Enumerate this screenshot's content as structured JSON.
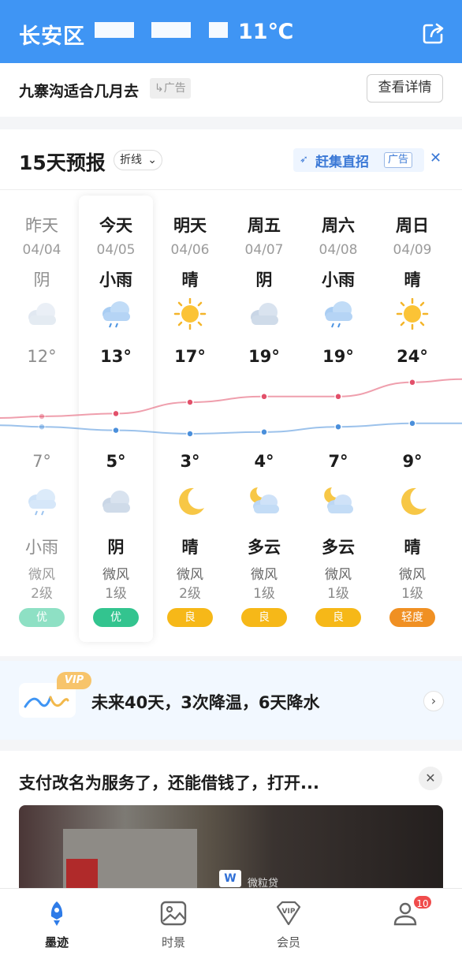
{
  "header": {
    "city": "长安区",
    "temperature": "11℃",
    "share_icon": "share-icon"
  },
  "ad_banner": {
    "title": "九寨沟适合几月去",
    "tag": "广告",
    "button": "查看详情"
  },
  "forecast": {
    "title": "15天预报",
    "mode": "折线",
    "ad": {
      "label": "赶集直招",
      "tag": "广告",
      "close": "✕"
    },
    "days": [
      {
        "day": "昨天",
        "date": "04/04",
        "weather_day": "阴",
        "icon_day": "cloud-icon",
        "high": "12°",
        "low": "7°",
        "icon_night": "cloud-rain-icon",
        "weather_night": "小雨",
        "wind": "微风",
        "level": "2级",
        "aqi": "优",
        "aqi_color": "#8ee0c4"
      },
      {
        "day": "今天",
        "date": "04/05",
        "weather_day": "小雨",
        "icon_day": "cloud-rain-icon",
        "high": "13°",
        "low": "5°",
        "icon_night": "cloud-icon",
        "weather_night": "阴",
        "wind": "微风",
        "level": "1级",
        "aqi": "优",
        "aqi_color": "#33c48f"
      },
      {
        "day": "明天",
        "date": "04/06",
        "weather_day": "晴",
        "icon_day": "sun-icon",
        "high": "17°",
        "low": "3°",
        "icon_night": "moon-icon",
        "weather_night": "晴",
        "wind": "微风",
        "level": "2级",
        "aqi": "良",
        "aqi_color": "#f6b818"
      },
      {
        "day": "周五",
        "date": "04/07",
        "weather_day": "阴",
        "icon_day": "cloud-icon",
        "high": "19°",
        "low": "4°",
        "icon_night": "moon-cloud-icon",
        "weather_night": "多云",
        "wind": "微风",
        "level": "1级",
        "aqi": "良",
        "aqi_color": "#f6b818"
      },
      {
        "day": "周六",
        "date": "04/08",
        "weather_day": "小雨",
        "icon_day": "cloud-rain-icon",
        "high": "19°",
        "low": "7°",
        "icon_night": "moon-cloud-icon",
        "weather_night": "多云",
        "wind": "微风",
        "level": "1级",
        "aqi": "良",
        "aqi_color": "#f6b818"
      },
      {
        "day": "周日",
        "date": "04/09",
        "weather_day": "晴",
        "icon_day": "sun-icon",
        "high": "24°",
        "low": "9°",
        "icon_night": "moon-icon",
        "weather_night": "晴",
        "wind": "微风",
        "level": "1级",
        "aqi": "轻度",
        "aqi_color": "#f09023"
      }
    ]
  },
  "chart_data": {
    "type": "line",
    "categories": [
      "04/04",
      "04/05",
      "04/06",
      "04/07",
      "04/08",
      "04/09"
    ],
    "series": [
      {
        "values": [
          12,
          13,
          17,
          19,
          19,
          24
        ],
        "color": "#e2506a"
      },
      {
        "values": [
          7,
          5,
          3,
          4,
          7,
          9
        ],
        "color": "#4a8fdb"
      }
    ]
  },
  "vip": {
    "badge": "VIP",
    "text": "未来40天，3次降温，6天降水",
    "arrow": "›"
  },
  "news": {
    "title": "支付改名为服务了，还能借钱了，打开...",
    "close": "✕",
    "image_caption": "微粒贷"
  },
  "tabbar": {
    "items": [
      {
        "label": "墨迹",
        "icon": "rocket-icon",
        "active": true
      },
      {
        "label": "时景",
        "icon": "image-icon",
        "active": false
      },
      {
        "label": "会员",
        "icon": "vip-icon",
        "active": false
      },
      {
        "label": "",
        "icon": "user-icon",
        "active": false
      }
    ],
    "badge": "10"
  }
}
